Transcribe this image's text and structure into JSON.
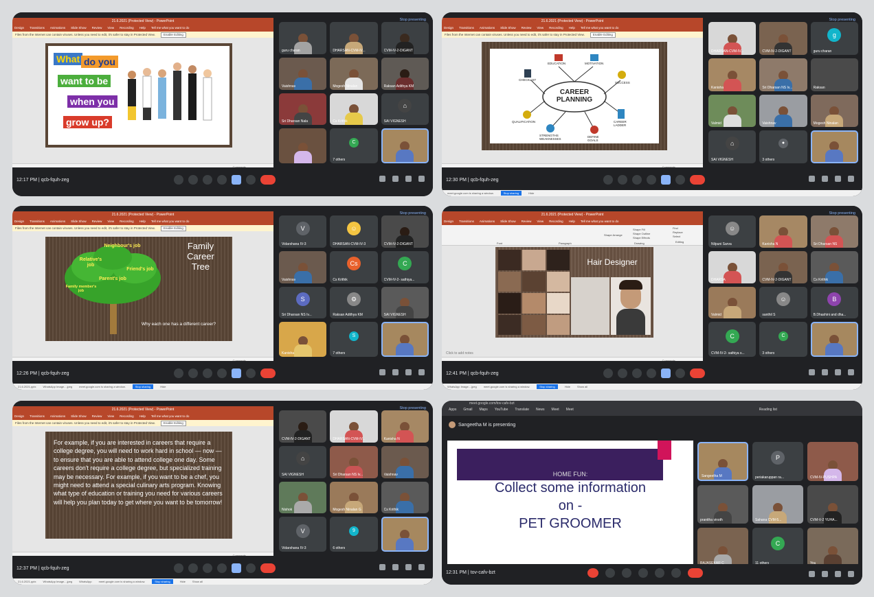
{
  "ppt": {
    "title": "21.6.2021 (Protected View) - PowerPoint",
    "user": "CHITTIRAND",
    "menu": [
      "File",
      "Home",
      "Insert",
      "Design",
      "Transitions",
      "Animations",
      "Slide Show",
      "Review",
      "View",
      "Recording",
      "Help",
      "Tell me what you want to do"
    ],
    "warning": "Files from the Internet can contain viruses. Unless you need to edit, it's safer to stay in Protected View.",
    "enable_btn": "Enable Editing",
    "status": "Comments"
  },
  "meet": {
    "stop_presenting": "Stop presenting",
    "code1": "qcb-fquh-zeg",
    "code2": "tov-cafv-bzt",
    "others7": "7 others",
    "others3": "3 others",
    "others6": "6 others",
    "others11": "11 others",
    "presenting": "Sangeetha M is presenting",
    "you": "You",
    "url": "meet.google.com/tov-cafv-bzt"
  },
  "taskbar": {
    "file1": "21.6.2021.pptx",
    "file2": "WhatsApp Image....jpeg",
    "file3": "WhatsApp",
    "share_msg": "meet.google.com is sharing a window.",
    "stop_sharing": "Stop sharing",
    "hide": "Hide",
    "show_all": "Show all"
  },
  "shot1": {
    "time": "12:17 PM",
    "slide": {
      "l1": "What",
      "l2": "do you",
      "l3": "want to be",
      "l4": "when you",
      "l5": "grow up?"
    },
    "names": [
      "guru charan",
      "DHARSAN-CVM-IV...",
      "CVM-IV-2-DIGANT",
      "Vaishnav",
      "Mogesh Ninalan",
      "Raksan Adithya KM",
      "Sri Dharsan Nala",
      "Cs Krithik",
      "SAI VIGNESH"
    ]
  },
  "shot2": {
    "time": "12:30 PM",
    "slide": {
      "center": "CAREER PLANNING",
      "education": "EDUCATION",
      "motivation": "MOTIVATION",
      "checklist": "CHECKLIST",
      "success": "SUCCESS",
      "qualification": "QUALIFICATION",
      "ladder": "CAREER LADDER",
      "strengths": "STRENGTHS WEAKNESSES",
      "goals": "DEFINE GOALS"
    },
    "names": [
      "DHARSAN-CVM-IV...",
      "CVM-IV-2-DIGANT",
      "guru charan",
      "Kanisha",
      "Sri Dharsan NS Iv...",
      "Raksan",
      "Valmid",
      "Vaishnav",
      "Mogesh Ninalan",
      "SAI VIGNESH"
    ]
  },
  "shot3": {
    "time": "12:26 PM",
    "slide": {
      "t1": "Family",
      "t2": "Career",
      "t3": "Tree",
      "neighbour": "Neighbour's job",
      "relative": "Relative's job",
      "friend": "Friend's job",
      "parent": "Parent's job",
      "family": "Family member's job",
      "question": "Why each one has a different career?"
    },
    "names": [
      "Vidarshana IV-3",
      "DHARSAN-CVM-IV-3",
      "CVM-IV-2-DIGANT",
      "Vaishnav",
      "Cs Krithik",
      "CVM-IV-2- sathiya...",
      "Sri Dharsan NS Iv...",
      "Raksan Adithya KM",
      "SAI VIGNESH",
      "Kanisha"
    ],
    "av": [
      "V",
      "Cs",
      "C",
      "S"
    ]
  },
  "shot4": {
    "time": "12:41 PM",
    "slide": {
      "title": "Hair Designer",
      "notes": "Click to add notes"
    },
    "ribbon": [
      "Find",
      "Replace",
      "Select",
      "Editing",
      "Shape Arrange",
      "Quick Styles",
      "Shape Fill",
      "Shape Outline",
      "Shape Effects",
      "Drawing",
      "Paragraph",
      "Font"
    ],
    "names": [
      "Nilpuni Sarva",
      "Kanisha N",
      "Sri Dharsan NS",
      "DHARSA",
      "CVM-IV-2-DIGANT",
      "Cs Krithik",
      "Valmid",
      "santhil S",
      "B.Dhashini and dha...",
      "CVM-IV-2- sathiya s..."
    ],
    "av": [
      "B",
      "C"
    ]
  },
  "shot5": {
    "time": "12:37 PM",
    "slide": "For example, if you are interested in careers that require a college degree, you will need to work hard in school — now — to ensure that you are able to attend college one day. Some careers don't require a college degree, but specialized training may be necessary. For example, if you want to be a chef, you might need to attend a special culinary arts program. Knowing what type of education or training you need for various careers will help you plan today to get where you want to be tomorrow!",
    "names": [
      "CVM-IV-2-DIGANT",
      "DHARSAN-CVM-IV...",
      "Kanisha N",
      "SAI VIGNESH",
      "Sri Dharsan NS Iv...",
      "Vaishnav",
      "Nishok",
      "Mogesh Ninalan G",
      "Cs Krithik",
      "Vidarshana IV-3"
    ],
    "av": [
      "V"
    ]
  },
  "shot6": {
    "time": "12:31 PM",
    "slide": {
      "l1": "HOME FUN:",
      "l2": "Collect some information",
      "l3": "on -",
      "l4": "PET GROOMER"
    },
    "bookmarks": [
      "Apps",
      "Gmail",
      "Maps",
      "YouTube",
      "Translate",
      "News",
      "Meet",
      "Reading list"
    ],
    "names": [
      "Sangeetha M",
      "periakaruppan ra...",
      "CVM-IV-PUSHPA",
      "pranitha vinoth",
      "Sahana CVM-5...",
      "CVM-V-2 YUHA...",
      "RAJASEKAR C",
      "You"
    ],
    "av": [
      "P",
      "C"
    ]
  },
  "colors": {
    "meet_bg": "#202124",
    "tile_bg": "#3c4043",
    "end_red": "#ea4335",
    "ppt_red": "#b7472a",
    "accent": "#8ab4f8"
  }
}
